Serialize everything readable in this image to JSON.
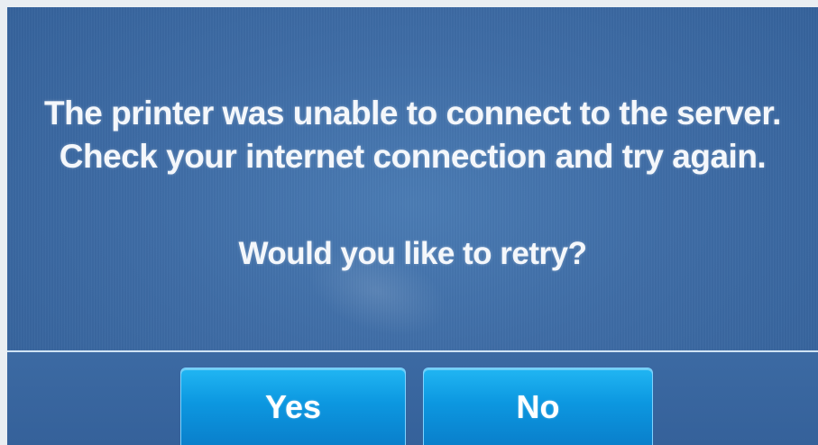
{
  "dialog": {
    "message_lines": [
      "The printer was unable to connect to the server.",
      "Check your internet connection and try again."
    ],
    "question": "Would you like to retry?",
    "yes_label": "Yes",
    "no_label": "No"
  },
  "colors": {
    "background": "#3f6da6",
    "button": "#0c97e0",
    "text": "#f4f7fb"
  }
}
